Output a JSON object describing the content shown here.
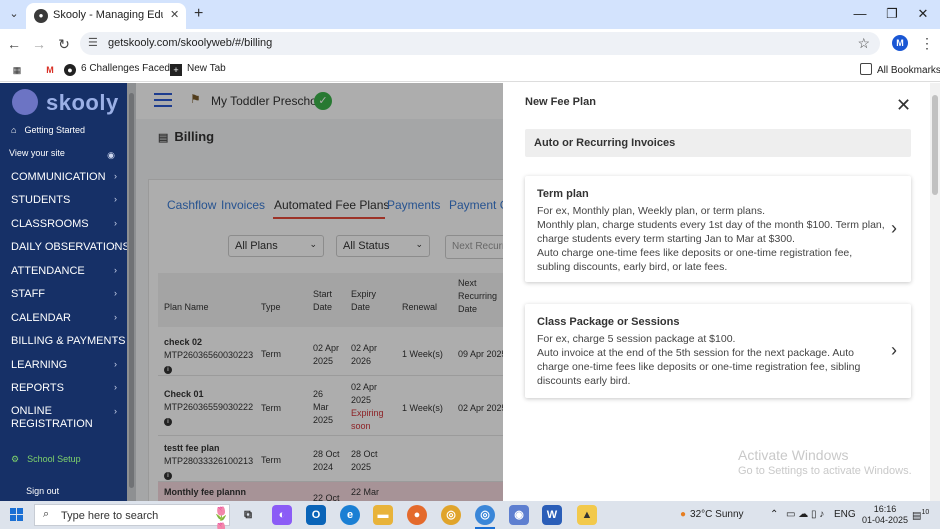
{
  "browser": {
    "tab_title": "Skooly - Managing Educational",
    "url": "getskooly.com/skoolyweb/#/billing",
    "profile_initial": "M",
    "bookmarks": [
      "6 Challenges Faced...",
      "New Tab"
    ],
    "all_bookmarks": "All Bookmarks"
  },
  "sidebar": {
    "logo": "skooly",
    "getting_started": "Getting Started",
    "view_site": "View your site",
    "items": [
      "COMMUNICATION",
      "STUDENTS",
      "CLASSROOMS",
      "DAILY OBSERVATIONS",
      "ATTENDANCE",
      "STAFF",
      "CALENDAR",
      "BILLING & PAYMENTS",
      "LEARNING",
      "REPORTS"
    ],
    "online_registration": [
      "ONLINE",
      "REGISTRATION"
    ],
    "school_setup": "School Setup",
    "sign_out": "Sign out"
  },
  "header": {
    "school_name": "My Toddler Preschool",
    "page_title": "Billing"
  },
  "billing": {
    "tabs": [
      "Cashflow",
      "Invoices",
      "Automated Fee Plans",
      "Payments",
      "Payment Ga"
    ],
    "active_tab": "Automated Fee Plans",
    "filter_plans": "All Plans",
    "filter_status": "All Status",
    "search_placeholder": "Next Recurrin",
    "columns": {
      "plan_name": "Plan Name",
      "type": "Type",
      "start_date": [
        "Start",
        "Date"
      ],
      "expiry_date": [
        "Expiry",
        "Date"
      ],
      "renewal": "Renewal",
      "next_recurring": [
        "Next",
        "Recurring",
        "Date"
      ]
    },
    "rows": [
      {
        "name": "check 02",
        "id": "MTP26036560030223",
        "type": "Term",
        "start": [
          "02 Apr",
          "2025"
        ],
        "expiry": [
          "02 Apr",
          "2026"
        ],
        "expiry_status": [],
        "renewal": "1 Week(s)",
        "next": "09 Apr 2025"
      },
      {
        "name": "Check 01",
        "id": "MTP26036559030222",
        "type": "Term",
        "start": [
          "26",
          "Mar",
          "2025"
        ],
        "expiry": [
          "02 Apr",
          "2025"
        ],
        "expiry_status": [
          "Expiring",
          "soon"
        ],
        "renewal": "1 Week(s)",
        "next": "02 Apr 2025"
      },
      {
        "name": "testt fee plan",
        "id": "MTP28033326100213",
        "type": "Term",
        "start": [
          "28 Oct",
          "2024"
        ],
        "expiry": [
          "28 Oct",
          "2025"
        ],
        "expiry_status": [],
        "renewal": "",
        "next": ""
      },
      {
        "name": "Monthly fee plannn",
        "id": "",
        "type": "",
        "start": [
          "22 Oct"
        ],
        "expiry": [
          "22 Mar"
        ],
        "expiry_status": [],
        "renewal": "",
        "next": ""
      }
    ]
  },
  "panel": {
    "title": "New Fee Plan",
    "section": "Auto or Recurring Invoices",
    "cards": [
      {
        "title": "Term plan",
        "lines": [
          "For ex, Monthly plan, Weekly plan, or term plans.",
          "Monthly plan, charge students every 1st day of the month $100. Term plan, charge students every term starting Jan to Mar at $300.",
          "Auto charge one-time fees like deposits or one-time registration fee, subling discounts, early bird, or late fees."
        ]
      },
      {
        "title": "Class Package or Sessions",
        "lines": [
          "For ex, charge 5 session package at $100.",
          "Auto invoice at the end of the 5th session for the next package. Auto charge one-time fees like deposits or one-time registration fee, sibling discounts early bird."
        ]
      }
    ],
    "watermark_title": "Activate Windows",
    "watermark_sub": "Go to Settings to activate Windows."
  },
  "taskbar": {
    "search_placeholder": "Type here to search",
    "weather": "32°C  Sunny",
    "language": "ENG",
    "time": "16:16",
    "date": "01-04-2025",
    "notifications": "10"
  },
  "colors": {
    "sidebar_bg": "#163067",
    "accent_red": "#e74c3c",
    "link_blue": "#3a7bd5",
    "badge_green": "#3bb34a"
  }
}
